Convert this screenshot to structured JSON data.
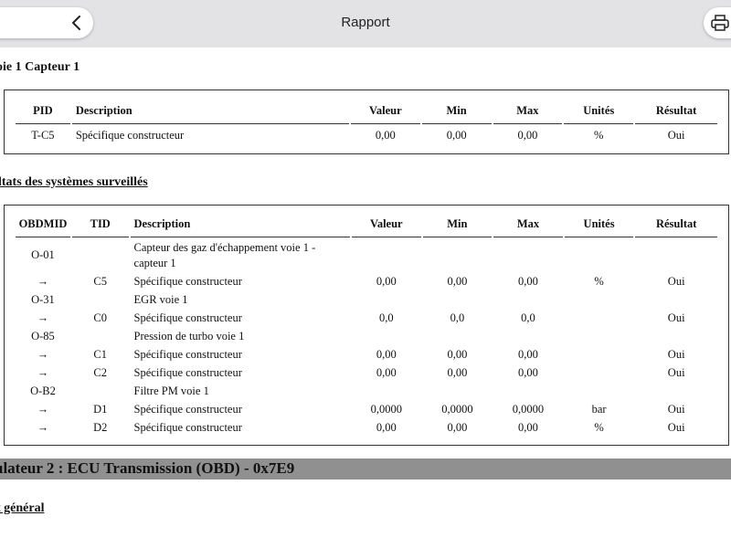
{
  "topbar": {
    "title": "Rapport",
    "back_icon": "chevron-left-icon",
    "print_icon": "printer-icon"
  },
  "section1": {
    "heading": "oie 1 Capteur 1",
    "columns": [
      "PID",
      "Description",
      "Valeur",
      "Min",
      "Max",
      "Unités",
      "Résultat"
    ],
    "rows": [
      {
        "pid": "T-C5",
        "description": "Spécifique constructeur",
        "valeur": "0,00",
        "min": "0,00",
        "max": "0,00",
        "unites": "%",
        "resultat": "Oui"
      }
    ]
  },
  "section2": {
    "heading": "ltats des systèmes surveillés",
    "columns": [
      "OBDMID",
      "TID",
      "Description",
      "Valeur",
      "Min",
      "Max",
      "Unités",
      "Résultat"
    ],
    "rows": [
      {
        "obdmid": "O-01",
        "tid": "",
        "description": "Capteur des gaz d'échappement voie 1 - capteur 1",
        "valeur": "",
        "min": "",
        "max": "",
        "unites": "",
        "resultat": ""
      },
      {
        "obdmid": "→",
        "tid": "C5",
        "description": "Spécifique constructeur",
        "valeur": "0,00",
        "min": "0,00",
        "max": "0,00",
        "unites": "%",
        "resultat": "Oui"
      },
      {
        "obdmid": "O-31",
        "tid": "",
        "description": "EGR voie 1",
        "valeur": "",
        "min": "",
        "max": "",
        "unites": "",
        "resultat": ""
      },
      {
        "obdmid": "→",
        "tid": "C0",
        "description": "Spécifique constructeur",
        "valeur": "0,0",
        "min": "0,0",
        "max": "0,0",
        "unites": "",
        "resultat": "Oui"
      },
      {
        "obdmid": "O-85",
        "tid": "",
        "description": "Pression de turbo voie 1",
        "valeur": "",
        "min": "",
        "max": "",
        "unites": "",
        "resultat": ""
      },
      {
        "obdmid": "→",
        "tid": "C1",
        "description": "Spécifique constructeur",
        "valeur": "0,00",
        "min": "0,00",
        "max": "0,00",
        "unites": "",
        "resultat": "Oui"
      },
      {
        "obdmid": "→",
        "tid": "C2",
        "description": "Spécifique constructeur",
        "valeur": "0,00",
        "min": "0,00",
        "max": "0,00",
        "unites": "",
        "resultat": "Oui"
      },
      {
        "obdmid": "O-B2",
        "tid": "",
        "description": "Filtre PM voie 1",
        "valeur": "",
        "min": "",
        "max": "",
        "unites": "",
        "resultat": ""
      },
      {
        "obdmid": "→",
        "tid": "D1",
        "description": "Spécifique constructeur",
        "valeur": "0,0000",
        "min": "0,0000",
        "max": "0,0000",
        "unites": "bar",
        "resultat": "Oui"
      },
      {
        "obdmid": "→",
        "tid": "D2",
        "description": "Spécifique constructeur",
        "valeur": "0,00",
        "min": "0,00",
        "max": "0,00",
        "unites": "%",
        "resultat": "Oui"
      }
    ]
  },
  "band": {
    "text": "ulateur 2 : ECU Transmission (OBD) - 0x7E9"
  },
  "section3": {
    "heading": "t général"
  }
}
